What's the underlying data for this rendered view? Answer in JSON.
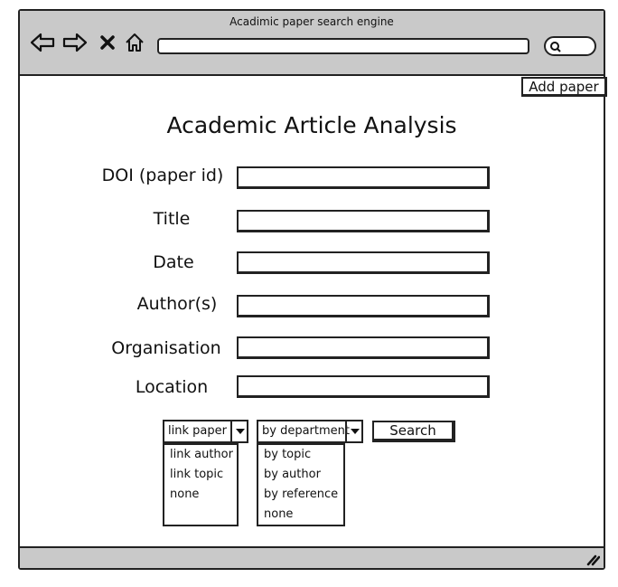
{
  "window": {
    "title": "Acadimic paper search engine",
    "url": "",
    "search_placeholder": ""
  },
  "icons": {
    "back": "back-arrow-icon",
    "forward": "forward-arrow-icon",
    "stop": "close-icon",
    "home": "home-icon",
    "search": "search-icon",
    "resize": "resize-grip-icon"
  },
  "toolbar": {
    "add_paper_label": "Add paper"
  },
  "page": {
    "heading": "Academic Article Analysis"
  },
  "form": {
    "fields": [
      {
        "label": "DOI (paper id)",
        "value": ""
      },
      {
        "label": "Title",
        "value": ""
      },
      {
        "label": "Date",
        "value": ""
      },
      {
        "label": "Author(s)",
        "value": ""
      },
      {
        "label": "Organisation",
        "value": ""
      },
      {
        "label": "Location",
        "value": ""
      }
    ],
    "link_select": {
      "selected": "link paper",
      "options": [
        "link author",
        "link topic",
        "none"
      ]
    },
    "group_select": {
      "selected": "by department",
      "options": [
        "by topic",
        "by author",
        "by reference",
        "none"
      ]
    },
    "search_label": "Search"
  },
  "colors": {
    "chrome": "#c9c9c9",
    "border": "#222222",
    "background": "#ffffff"
  }
}
